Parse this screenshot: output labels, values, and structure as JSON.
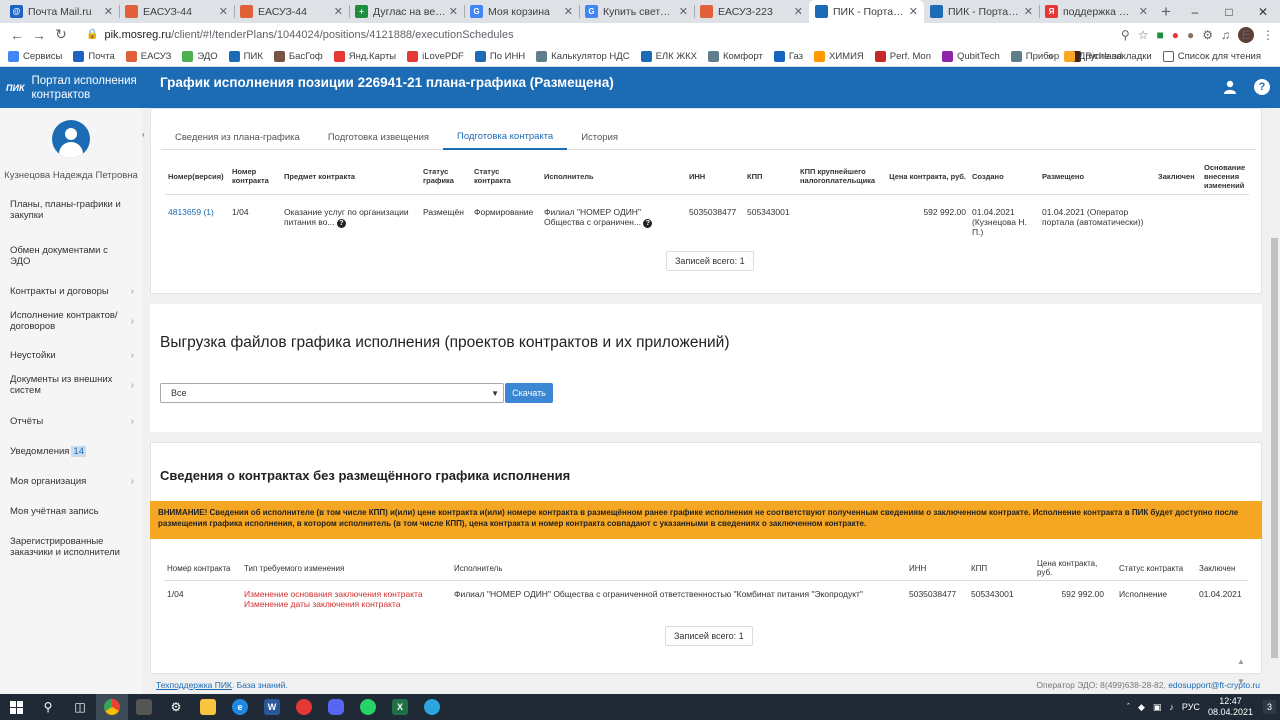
{
  "browser": {
    "tabs": [
      {
        "title": "Почта Mail.ru",
        "color": "#1e62c3",
        "glyph": "@"
      },
      {
        "title": "ЕАСУЗ-44",
        "color": "#e0603a",
        "glyph": ""
      },
      {
        "title": "ЕАСУЗ-44",
        "color": "#e0603a",
        "glyph": ""
      },
      {
        "title": "Дуглас на весну 20",
        "color": "#1e8e3e",
        "glyph": "+"
      },
      {
        "title": "Моя корзина",
        "color": "#4285f4",
        "glyph": "G"
      },
      {
        "title": "Купить светодиодн",
        "color": "#4285f4",
        "glyph": "G"
      },
      {
        "title": "ЕАСУЗ-223",
        "color": "#e0603a",
        "glyph": ""
      },
      {
        "title": "ПИК - Портал испо",
        "color": "#1c6bb5",
        "glyph": ""
      },
      {
        "title": "ПИК - Портал испо",
        "color": "#1c6bb5",
        "glyph": ""
      },
      {
        "title": "поддержка ПИК 44",
        "color": "#e53935",
        "glyph": "Я"
      }
    ],
    "active_tab_index": 7,
    "url_host": "pik.mosreg.ru",
    "url_path": "/client/#!/tenderPlans/1044024/positions/4121888/executionSchedules",
    "profile_letter": "E",
    "bookmarks": [
      {
        "label": "Сервисы",
        "color": "#4285f4"
      },
      {
        "label": "Почта",
        "color": "#1e62c3"
      },
      {
        "label": "ЕАСУЗ",
        "color": "#e0603a"
      },
      {
        "label": "ЭДО",
        "color": "#4caf50"
      },
      {
        "label": "ПИК",
        "color": "#1c6bb5"
      },
      {
        "label": "БасГоф",
        "color": "#795548"
      },
      {
        "label": "Янд.Карты",
        "color": "#e53935"
      },
      {
        "label": "iLovePDF",
        "color": "#e53935"
      },
      {
        "label": "По ИНН",
        "color": "#1c6bb5"
      },
      {
        "label": "Калькулятор НДС",
        "color": "#607d8b"
      },
      {
        "label": "ЕЛК ЖКХ",
        "color": "#1c6bb5"
      },
      {
        "label": "Комфорт",
        "color": "#607d8b"
      },
      {
        "label": "Газ",
        "color": "#1565c0"
      },
      {
        "label": "ХИМИЯ",
        "color": "#ff9800"
      },
      {
        "label": "Perf. Mon",
        "color": "#c62828"
      },
      {
        "label": "QubitTech",
        "color": "#8e24aa"
      },
      {
        "label": "Прибор",
        "color": "#607d8b"
      },
      {
        "label": "Richland",
        "color": "#3e2723"
      }
    ],
    "bookmarks_more": "»",
    "other_bookmarks": "Другие закладки",
    "reading_list": "Список для чтения"
  },
  "app": {
    "logo_text": "Портал исполнения контрактов",
    "logo_mark": "ПИК",
    "page_title": "График исполнения позиции 226941-21 плана-графика (Размещена)"
  },
  "sidebar": {
    "user_name": "Кузнецова Надежда Петровна",
    "items": [
      {
        "label": "Планы, планы-графики и закупки",
        "chevron": false
      },
      {
        "label": "Обмен документами с ЭДО",
        "chevron": false
      },
      {
        "label": "Контракты и договоры",
        "chevron": true
      },
      {
        "label": "Исполнение контрактов/договоров",
        "chevron": true
      },
      {
        "label": "Неустойки",
        "chevron": true
      },
      {
        "label": "Документы из внешних систем",
        "chevron": true
      },
      {
        "label": "Отчёты",
        "chevron": true
      },
      {
        "label": "Уведомления",
        "chevron": false,
        "badge": "14"
      },
      {
        "label": "Моя организация",
        "chevron": true
      },
      {
        "label": "Моя учётная запись",
        "chevron": false
      },
      {
        "label": "Зарегистрированные заказчики и исполнители",
        "chevron": false
      }
    ]
  },
  "content_tabs": [
    "Сведения из плана-графика",
    "Подготовка извещения",
    "Подготовка контракта",
    "История"
  ],
  "active_content_tab": 2,
  "contracts_table": {
    "headers": [
      "Номер(версия)",
      "Номер контракта",
      "Предмет контракта",
      "Статус графика",
      "Статус контракта",
      "Исполнитель",
      "ИНН",
      "КПП",
      "КПП крупнейшего налогоплательщика",
      "Цена контракта, руб.",
      "Создано",
      "Размещено",
      "Заключен",
      "Основание внесения изменений"
    ],
    "rows": [
      {
        "version": "4813659 (1)",
        "number": "1/04",
        "subject": "Оказание услуг по организации питания во...",
        "schedule_status": "Размещён",
        "contract_status": "Формирование",
        "executor": "Филиал \"НОМЕР ОДИН\" Общества с ограничен...",
        "inn": "5035038477",
        "kpp": "505343001",
        "kpp_largest": "",
        "price": "592 992.00",
        "created": "01.04.2021 (Кузнецова Н. П.)",
        "placed": "01.04.2021 (Оператор портала (автоматически))",
        "concluded": "",
        "basis": ""
      }
    ],
    "total_label": "Записей всего: 1"
  },
  "export_section": {
    "title": "Выгрузка файлов графика исполнения (проектов контрактов и их приложений)",
    "select_value": "Все",
    "button_label": "Скачать"
  },
  "no_schedule_section": {
    "title": "Сведения о контрактах без размещённого графика исполнения",
    "warning": "ВНИМАНИЕ! Сведения об исполнителе (в том числе КПП) и(или) цене контракта и(или) номере контракта в размещённом ранее графике исполнения не соответствуют полученным сведениям о заключенном контракте. Исполнение контракта в ПИК будет доступно после размещения графика исполнения, в котором исполнитель (в том числе КПП), цена контракта и номер контракта совпадают с указанными в сведениях о заключенном контракте.",
    "warning_color": "#f5a623",
    "headers": [
      "Номер контракта",
      "Тип требуемого изменения",
      "Исполнитель",
      "ИНН",
      "КПП",
      "Цена контракта, руб.",
      "Статус контракта",
      "Заключен"
    ],
    "rows": [
      {
        "number": "1/04",
        "change_1": "Изменение основания заключения контракта",
        "change_2": "Изменение даты заключения контракта",
        "executor": "Филиал \"НОМЕР ОДИН\" Общества с ограниченной ответственностью \"Комбинат питания \"Экопродукт\"",
        "inn": "5035038477",
        "kpp": "505343001",
        "price": "592 992.00",
        "status": "Исполнение",
        "concluded": "01.04.2021"
      }
    ],
    "total_label": "Записей всего: 1"
  },
  "footer": {
    "support_link": "Техподдержка ПИК",
    "kb_link": "База знаний.",
    "operator_text": "Оператор ЭДО: 8(499)638-28-82,",
    "operator_email": "edosupport@ft-crypto.ru"
  },
  "taskbar": {
    "lang": "РУС",
    "time": "12:47",
    "date": "08.04.2021",
    "notif_count": "3"
  }
}
